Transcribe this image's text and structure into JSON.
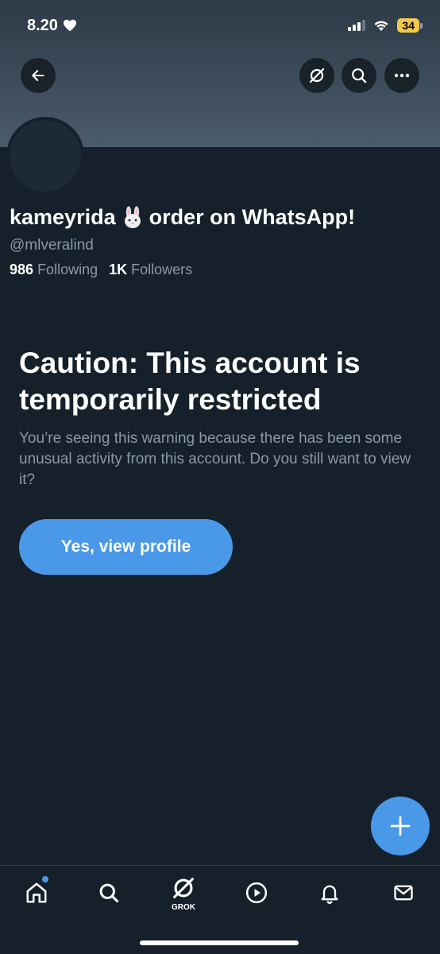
{
  "status_bar": {
    "time": "8.20",
    "battery": "34"
  },
  "profile": {
    "name": "kameyrida",
    "name_suffix": "order on WhatsApp!",
    "handle": "@mlveralind",
    "following_count": "986",
    "following_label": "Following",
    "followers_count": "1K",
    "followers_label": "Followers"
  },
  "caution": {
    "title": "Caution: This account is temporarily restricted",
    "body": "You’re seeing this warning because there has been some unusual activity from this account. Do you still want to view it?",
    "button_label": "Yes, view profile"
  },
  "bottom_nav": {
    "grok_label": "GROK",
    "items": [
      "home-icon",
      "search-icon",
      "grok-icon",
      "video-icon",
      "notifications-icon",
      "messages-icon"
    ]
  },
  "colors": {
    "background": "#15202b",
    "accent": "#4a99e9",
    "secondary_text": "#8b98a5"
  }
}
